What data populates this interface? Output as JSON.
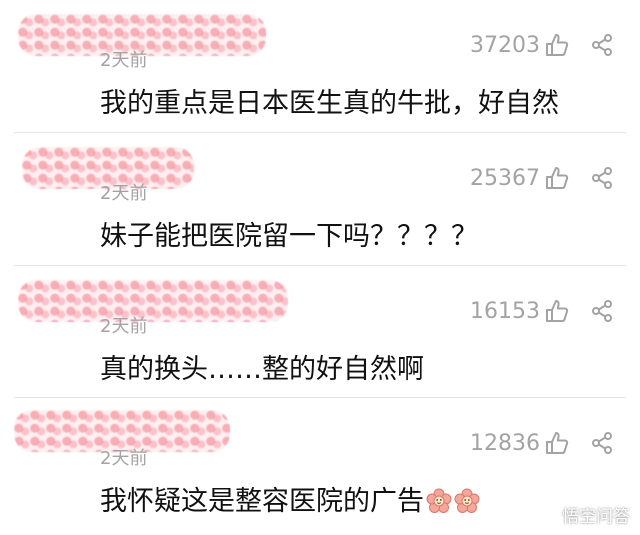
{
  "comments": [
    {
      "time": "2天前",
      "likes": "37203",
      "text": "我的重点是日本医生真的牛批，好自然"
    },
    {
      "time": "2天前",
      "likes": "25367",
      "text": "妹子能把医院留一下吗？？？？"
    },
    {
      "time": "2天前",
      "likes": "16153",
      "text": "真的换头……整的好自然啊"
    },
    {
      "time": "2天前",
      "likes": "12836",
      "text": "我怀疑这是整容医院的广告",
      "emojis": [
        "flower-emoji",
        "flower-emoji"
      ]
    }
  ],
  "watermark": {
    "text": "悟空问答"
  },
  "icons": {
    "like": "thumbs-up-icon",
    "share": "share-icon"
  },
  "colors": {
    "meta_gray": "#a3a3a3",
    "text": "#111111",
    "redaction_pink": "#f07887"
  }
}
